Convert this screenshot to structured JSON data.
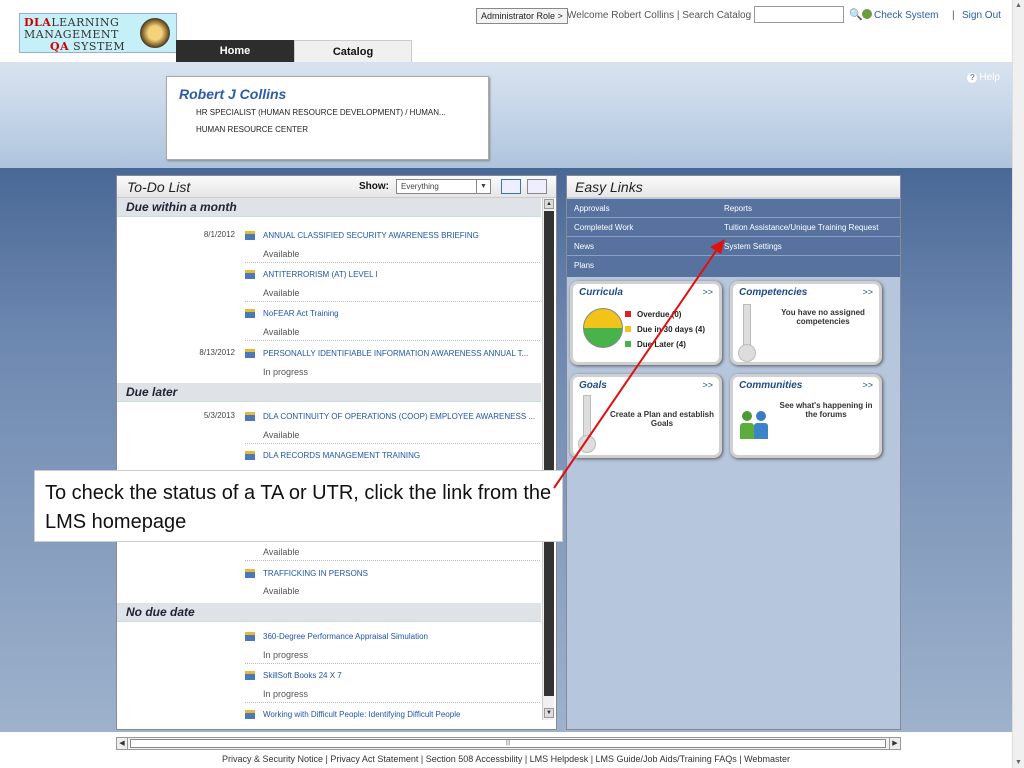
{
  "header": {
    "logo": {
      "line1_red": "DLA",
      "line1": "LEARNING",
      "line2": "MANAGEMENT",
      "line3_red": "QA",
      "line3": "SYSTEM"
    },
    "tabs": [
      {
        "label": "Home"
      },
      {
        "label": "Catalog"
      }
    ],
    "admin_role": "Administrator Role >",
    "welcome": "Welcome Robert Collins | Search Catalog",
    "search_value": "",
    "check_system": "Check System",
    "separator": "|",
    "sign_out": "Sign Out"
  },
  "profile": {
    "help": "Help",
    "name": "Robert J Collins",
    "title": "HR SPECIALIST (HUMAN RESOURCE DEVELOPMENT) / HUMAN...",
    "org": "HUMAN RESOURCE CENTER"
  },
  "todo": {
    "title": "To-Do List",
    "show_label": "Show:",
    "show_value": "Everything",
    "groups": [
      {
        "label": "Due within a month"
      },
      {
        "label": "Due later"
      },
      {
        "label": "No due date"
      }
    ],
    "items": [
      {
        "date": "8/1/2012",
        "title": "ANNUAL CLASSIFIED SECURITY AWARENESS BRIEFING",
        "status": "Available"
      },
      {
        "date": "",
        "title": "ANTITERRORISM (AT) LEVEL I",
        "status": "Available"
      },
      {
        "date": "",
        "title": "NoFEAR Act Training",
        "status": "Available"
      },
      {
        "date": "8/13/2012",
        "title": "PERSONALLY IDENTIFIABLE INFORMATION AWARENESS ANNUAL T...",
        "status": "In progress"
      },
      {
        "date": "5/3/2013",
        "title": "DLA CONTINUITY OF OPERATIONS (COOP) EMPLOYEE AWARENESS ...",
        "status": "Available"
      },
      {
        "date": "",
        "title": "DLA RECORDS MANAGEMENT TRAINING",
        "status": ""
      },
      {
        "date": "",
        "title": "",
        "status": "Available"
      },
      {
        "date": "",
        "title": "TRAFFICKING IN PERSONS",
        "status": "Available"
      },
      {
        "date": "",
        "title": "360-Degree Performance Appraisal Simulation",
        "status": "In progress"
      },
      {
        "date": "",
        "title": "SkillSoft Books 24 X 7",
        "status": "In progress"
      },
      {
        "date": "",
        "title": "Working with Difficult People: Identifying Difficult People",
        "status": ""
      }
    ]
  },
  "easy_links": {
    "title": "Easy Links",
    "links": [
      {
        "label": "Approvals"
      },
      {
        "label": "Reports"
      },
      {
        "label": "Completed Work"
      },
      {
        "label": "Tuition Assistance/Unique Training Request"
      },
      {
        "label": "News"
      },
      {
        "label": "System Settings"
      },
      {
        "label": "Plans"
      }
    ],
    "widgets": {
      "curricula": {
        "title": "Curricula",
        "more": ">>",
        "legend": [
          {
            "label": "Overdue (0)",
            "color": "#e02020"
          },
          {
            "label": "Due in 30 days (4)",
            "color": "#f2c318"
          },
          {
            "label": "Due Later (4)",
            "color": "#47b34a"
          }
        ]
      },
      "competencies": {
        "title": "Competencies",
        "more": ">>",
        "message": "You have no assigned competencies"
      },
      "goals": {
        "title": "Goals",
        "more": ">>",
        "message": "Create a Plan and establish Goals"
      },
      "communities": {
        "title": "Communities",
        "more": ">>",
        "message": "See what's happening in the forums"
      }
    }
  },
  "callout": {
    "text": "To check the status of a TA or UTR, click the link from the LMS homepage"
  },
  "footer": {
    "text": "Privacy & Security Notice | Privacy Act Statement | Section 508 Accessbility | LMS Helpdesk | LMS Guide/Job Aids/Training FAQs | Webmaster"
  },
  "colors": {
    "link": "#1f56a8",
    "accent_red": "#e01010",
    "band": "#5872a0"
  },
  "icons": {
    "search": "magnifier-icon",
    "help": "question-circle-icon",
    "check": "check-system-icon"
  }
}
